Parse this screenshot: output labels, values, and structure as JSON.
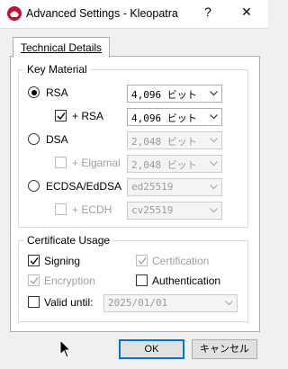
{
  "window": {
    "title": "Advanced Settings - Kleopatra",
    "help_label": "?",
    "close_label": "✕"
  },
  "tabs": [
    {
      "label": "Technical Details"
    }
  ],
  "key_material": {
    "group_label": "Key Material",
    "rsa": {
      "label": "RSA",
      "selected": true,
      "size": "4,096 ビット"
    },
    "rsa_sub": {
      "label": "+ RSA",
      "checked": true,
      "size": "4,096 ビット"
    },
    "dsa": {
      "label": "DSA",
      "selected": false,
      "size": "2,048 ビット"
    },
    "dsa_sub": {
      "label": "+ Elgamal",
      "checked": false,
      "size": "2,048 ビット"
    },
    "ecdsa": {
      "label": "ECDSA/EdDSA",
      "selected": false,
      "curve": "ed25519"
    },
    "ecdsa_sub": {
      "label": "+ ECDH",
      "checked": false,
      "curve": "cv25519"
    }
  },
  "certificate_usage": {
    "group_label": "Certificate Usage",
    "signing": {
      "label": "Signing",
      "checked": true
    },
    "certification": {
      "label": "Certification",
      "checked": true,
      "disabled": true
    },
    "encryption": {
      "label": "Encryption",
      "checked": true,
      "disabled": true
    },
    "authentication": {
      "label": "Authentication",
      "checked": false
    },
    "valid_until": {
      "label": "Valid until:",
      "checked": false,
      "date": "2025/01/01"
    }
  },
  "buttons": {
    "ok": "OK",
    "cancel": "キャンセル"
  },
  "colors": {
    "accent": "#0078d7",
    "title_icon": "#c8102e"
  }
}
